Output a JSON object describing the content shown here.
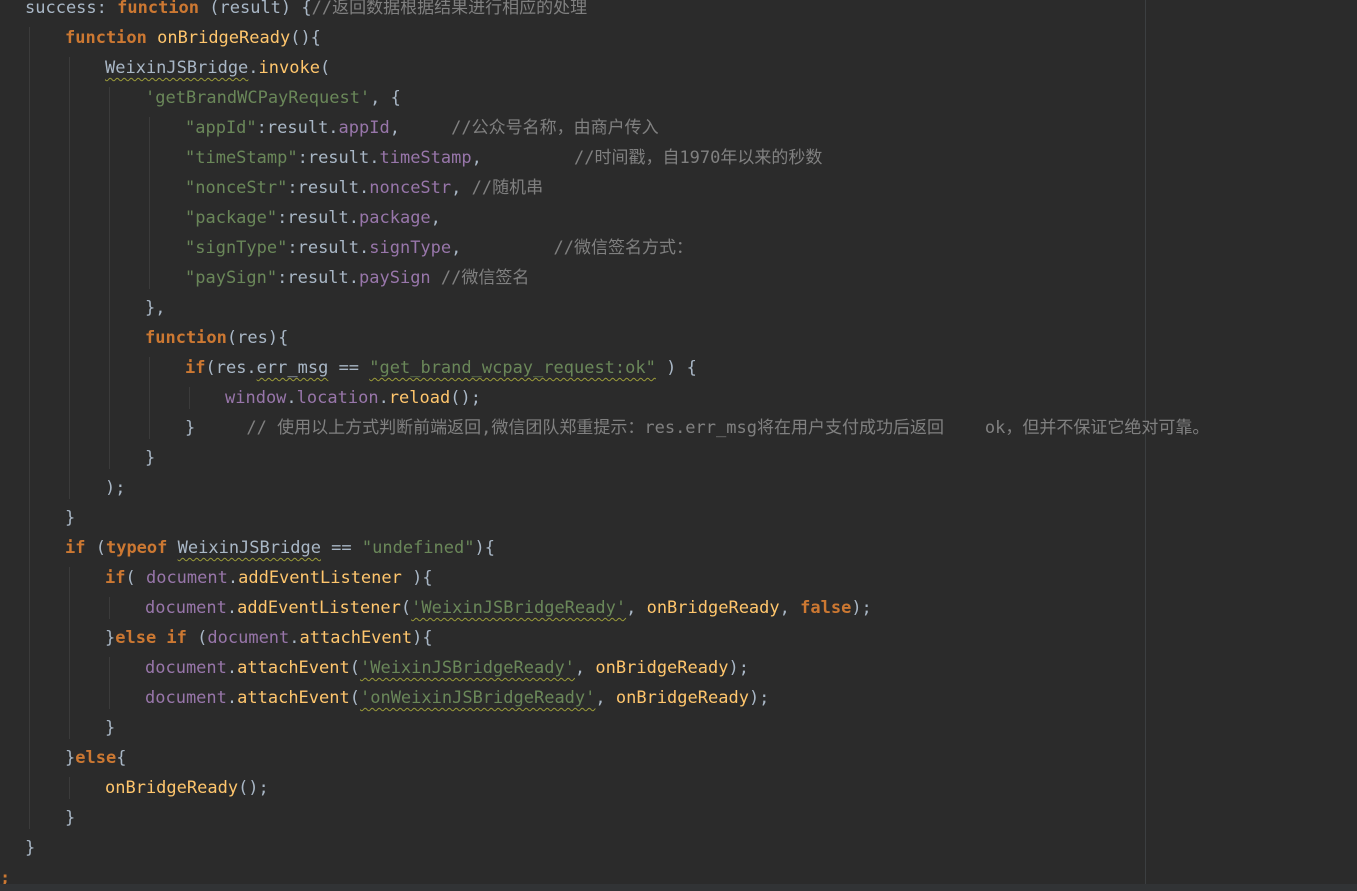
{
  "editor": {
    "colors": {
      "background": "#2b2b2b",
      "text": "#a9b7c6",
      "keyword": "#cc7832",
      "function": "#ffc66d",
      "string": "#6a8759",
      "comment": "#808080",
      "property": "#9876aa"
    },
    "lines": [
      {
        "indent": 0,
        "tokens": [
          {
            "t": "success",
            "c": "text"
          },
          {
            "t": ": ",
            "c": "text"
          },
          {
            "t": "function",
            "c": "kw"
          },
          {
            "t": " (result) {",
            "c": "text"
          },
          {
            "t": "//返回数据根据结果进行相应的处理",
            "c": "cmt"
          }
        ]
      },
      {
        "indent": 1,
        "tokens": [
          {
            "t": "function",
            "c": "kw"
          },
          {
            "t": " ",
            "c": "text"
          },
          {
            "t": "onBridgeReady",
            "c": "fn"
          },
          {
            "t": "(){",
            "c": "text"
          }
        ]
      },
      {
        "indent": 2,
        "tokens": [
          {
            "t": "WeixinJSBridge",
            "c": "text",
            "sq": true
          },
          {
            "t": ".",
            "c": "text"
          },
          {
            "t": "invoke",
            "c": "fn"
          },
          {
            "t": "(",
            "c": "text"
          }
        ]
      },
      {
        "indent": 3,
        "tokens": [
          {
            "t": "'getBrandWCPayRequest'",
            "c": "str"
          },
          {
            "t": ", {",
            "c": "text"
          }
        ]
      },
      {
        "indent": 4,
        "tokens": [
          {
            "t": "\"appId\"",
            "c": "str"
          },
          {
            "t": ":result.",
            "c": "text"
          },
          {
            "t": "appId",
            "c": "prop"
          },
          {
            "t": ",     ",
            "c": "text"
          },
          {
            "t": "//公众号名称，由商户传入",
            "c": "cmt"
          }
        ]
      },
      {
        "indent": 4,
        "tokens": [
          {
            "t": "\"timeStamp\"",
            "c": "str"
          },
          {
            "t": ":result.",
            "c": "text"
          },
          {
            "t": "timeStamp",
            "c": "prop"
          },
          {
            "t": ",         ",
            "c": "text"
          },
          {
            "t": "//时间戳，自1970年以来的秒数",
            "c": "cmt"
          }
        ]
      },
      {
        "indent": 4,
        "tokens": [
          {
            "t": "\"nonceStr\"",
            "c": "str"
          },
          {
            "t": ":result.",
            "c": "text"
          },
          {
            "t": "nonceStr",
            "c": "prop"
          },
          {
            "t": ", ",
            "c": "text"
          },
          {
            "t": "//随机串",
            "c": "cmt"
          }
        ]
      },
      {
        "indent": 4,
        "tokens": [
          {
            "t": "\"package\"",
            "c": "str"
          },
          {
            "t": ":result.",
            "c": "text"
          },
          {
            "t": "package",
            "c": "prop"
          },
          {
            "t": ",",
            "c": "text"
          }
        ]
      },
      {
        "indent": 4,
        "tokens": [
          {
            "t": "\"signType\"",
            "c": "str"
          },
          {
            "t": ":result.",
            "c": "text"
          },
          {
            "t": "signType",
            "c": "prop"
          },
          {
            "t": ",         ",
            "c": "text"
          },
          {
            "t": "//微信签名方式：",
            "c": "cmt"
          }
        ]
      },
      {
        "indent": 4,
        "tokens": [
          {
            "t": "\"paySign\"",
            "c": "str"
          },
          {
            "t": ":result.",
            "c": "text"
          },
          {
            "t": "paySign",
            "c": "prop"
          },
          {
            "t": " ",
            "c": "text"
          },
          {
            "t": "//微信签名",
            "c": "cmt"
          }
        ]
      },
      {
        "indent": 3,
        "tokens": [
          {
            "t": "},",
            "c": "text"
          }
        ]
      },
      {
        "indent": 3,
        "tokens": [
          {
            "t": "function",
            "c": "kw"
          },
          {
            "t": "(res){",
            "c": "text"
          }
        ]
      },
      {
        "indent": 4,
        "tokens": [
          {
            "t": "if",
            "c": "kw"
          },
          {
            "t": "(res.",
            "c": "text"
          },
          {
            "t": "err_msg",
            "c": "text",
            "sq": true
          },
          {
            "t": " == ",
            "c": "text"
          },
          {
            "t": "\"get_brand_wcpay_request:ok\"",
            "c": "str",
            "sq": true
          },
          {
            "t": " ) {",
            "c": "text"
          }
        ]
      },
      {
        "indent": 5,
        "tokens": [
          {
            "t": "window",
            "c": "prop"
          },
          {
            "t": ".",
            "c": "text"
          },
          {
            "t": "location",
            "c": "prop"
          },
          {
            "t": ".",
            "c": "text"
          },
          {
            "t": "reload",
            "c": "fn"
          },
          {
            "t": "();",
            "c": "text"
          }
        ]
      },
      {
        "indent": 4,
        "tokens": [
          {
            "t": "}     ",
            "c": "text"
          },
          {
            "t": "// 使用以上方式判断前端返回,微信团队郑重提示：res.err_msg将在用户支付成功后返回    ok，但并不保证它绝对可靠。",
            "c": "cmt"
          }
        ]
      },
      {
        "indent": 3,
        "tokens": [
          {
            "t": "}",
            "c": "text"
          }
        ]
      },
      {
        "indent": 2,
        "tokens": [
          {
            "t": ");",
            "c": "text"
          }
        ]
      },
      {
        "indent": 1,
        "tokens": [
          {
            "t": "}",
            "c": "text"
          }
        ]
      },
      {
        "indent": 1,
        "tokens": [
          {
            "t": "if",
            "c": "kw"
          },
          {
            "t": " (",
            "c": "text"
          },
          {
            "t": "typeof",
            "c": "kw"
          },
          {
            "t": " ",
            "c": "text"
          },
          {
            "t": "WeixinJSBridge",
            "c": "text",
            "sq": true
          },
          {
            "t": " == ",
            "c": "text"
          },
          {
            "t": "\"undefined\"",
            "c": "str"
          },
          {
            "t": "){",
            "c": "text"
          }
        ]
      },
      {
        "indent": 2,
        "tokens": [
          {
            "t": "if",
            "c": "kw"
          },
          {
            "t": "( ",
            "c": "text"
          },
          {
            "t": "document",
            "c": "prop"
          },
          {
            "t": ".",
            "c": "text"
          },
          {
            "t": "addEventListener",
            "c": "fn"
          },
          {
            "t": " ){",
            "c": "text"
          }
        ]
      },
      {
        "indent": 3,
        "tokens": [
          {
            "t": "document",
            "c": "prop"
          },
          {
            "t": ".",
            "c": "text"
          },
          {
            "t": "addEventListener",
            "c": "fn"
          },
          {
            "t": "(",
            "c": "text"
          },
          {
            "t": "'WeixinJSBridgeReady'",
            "c": "str",
            "sq": true
          },
          {
            "t": ", ",
            "c": "text"
          },
          {
            "t": "onBridgeReady",
            "c": "fn"
          },
          {
            "t": ", ",
            "c": "text"
          },
          {
            "t": "false",
            "c": "kw"
          },
          {
            "t": ");",
            "c": "text"
          }
        ]
      },
      {
        "indent": 2,
        "tokens": [
          {
            "t": "}",
            "c": "text"
          },
          {
            "t": "else if",
            "c": "kw"
          },
          {
            "t": " (",
            "c": "text"
          },
          {
            "t": "document",
            "c": "prop"
          },
          {
            "t": ".",
            "c": "text"
          },
          {
            "t": "attachEvent",
            "c": "fn"
          },
          {
            "t": "){",
            "c": "text"
          }
        ]
      },
      {
        "indent": 3,
        "tokens": [
          {
            "t": "document",
            "c": "prop"
          },
          {
            "t": ".",
            "c": "text"
          },
          {
            "t": "attachEvent",
            "c": "fn"
          },
          {
            "t": "(",
            "c": "text"
          },
          {
            "t": "'WeixinJSBridgeReady'",
            "c": "str",
            "sq": true
          },
          {
            "t": ", ",
            "c": "text"
          },
          {
            "t": "onBridgeReady",
            "c": "fn"
          },
          {
            "t": ");",
            "c": "text"
          }
        ]
      },
      {
        "indent": 3,
        "tokens": [
          {
            "t": "document",
            "c": "prop"
          },
          {
            "t": ".",
            "c": "text"
          },
          {
            "t": "attachEvent",
            "c": "fn"
          },
          {
            "t": "(",
            "c": "text"
          },
          {
            "t": "'onWeixinJSBridgeReady'",
            "c": "str",
            "sq": true
          },
          {
            "t": ", ",
            "c": "text"
          },
          {
            "t": "onBridgeReady",
            "c": "fn"
          },
          {
            "t": ");",
            "c": "text"
          }
        ]
      },
      {
        "indent": 2,
        "tokens": [
          {
            "t": "}",
            "c": "text"
          }
        ]
      },
      {
        "indent": 1,
        "tokens": [
          {
            "t": "}",
            "c": "text"
          },
          {
            "t": "else",
            "c": "kw"
          },
          {
            "t": "{",
            "c": "text"
          }
        ]
      },
      {
        "indent": 2,
        "tokens": [
          {
            "t": "onBridgeReady",
            "c": "fn"
          },
          {
            "t": "();",
            "c": "text"
          }
        ]
      },
      {
        "indent": 1,
        "tokens": [
          {
            "t": "}",
            "c": "text"
          }
        ]
      },
      {
        "indent": 0,
        "tokens": [
          {
            "t": "}",
            "c": "text"
          }
        ]
      },
      {
        "indent": -1,
        "tokens": [
          {
            "t": ";",
            "c": "kw"
          }
        ]
      }
    ]
  }
}
